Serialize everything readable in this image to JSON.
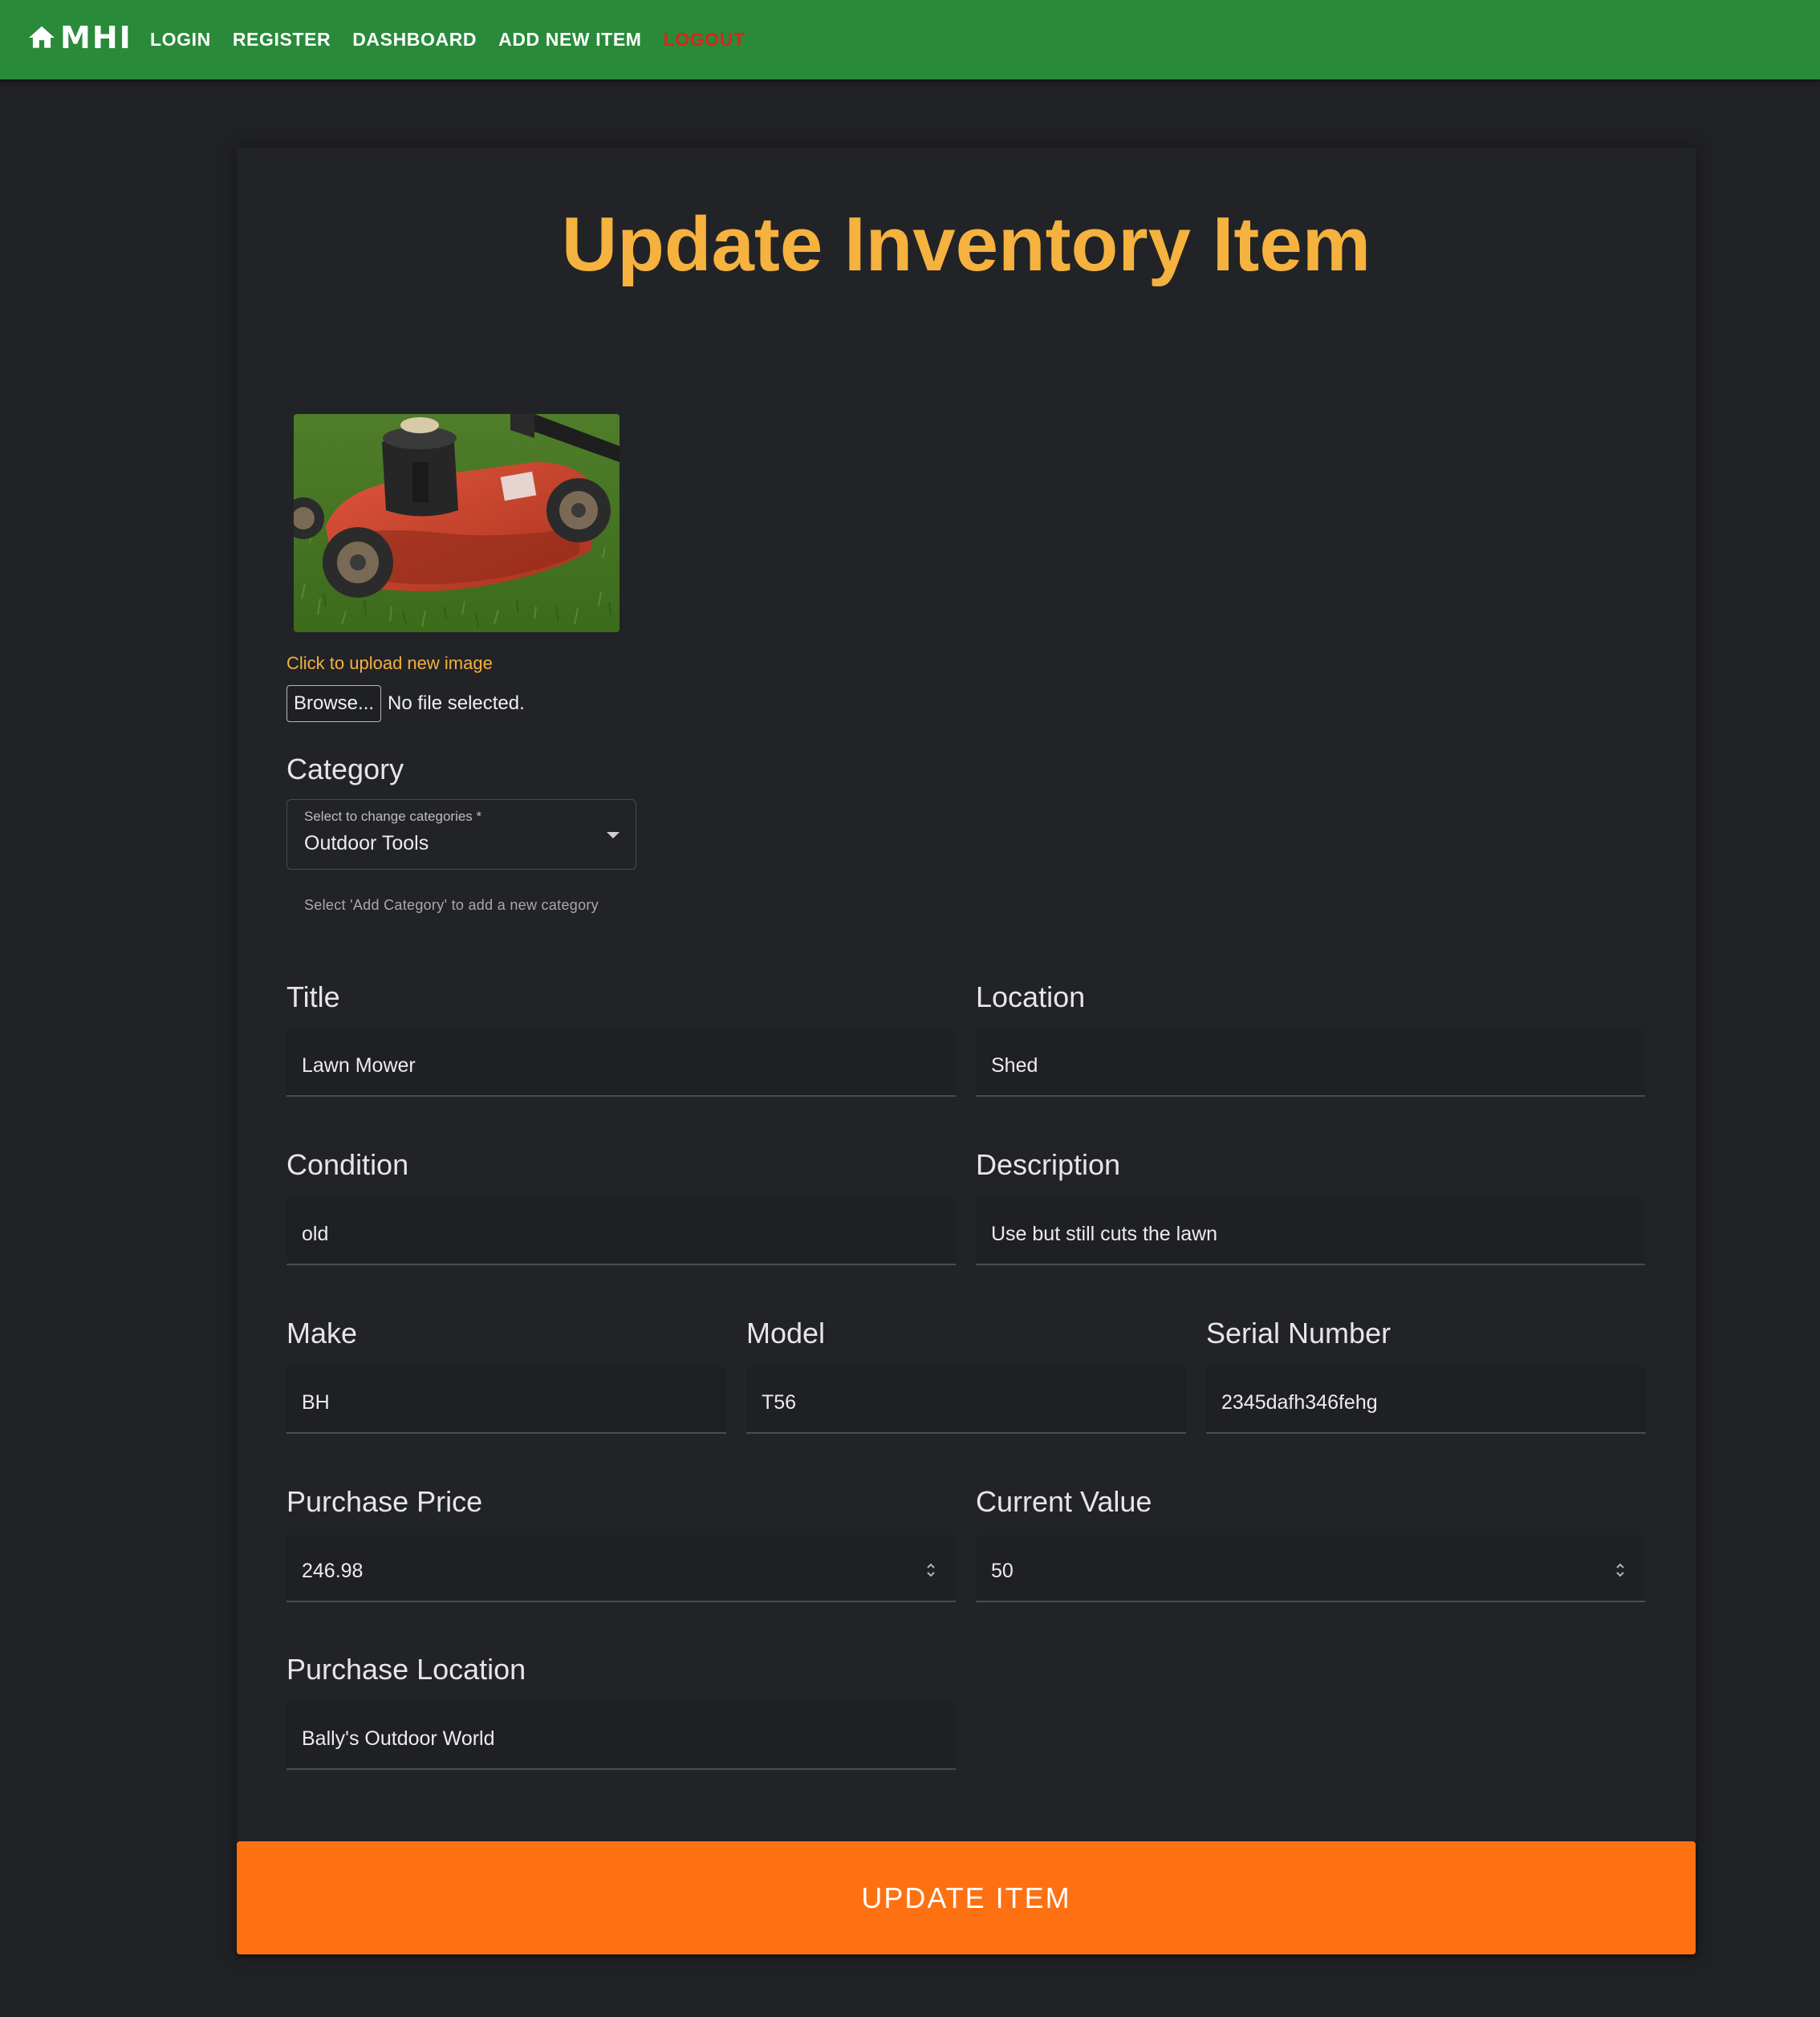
{
  "nav": {
    "brand": "MHI",
    "links": [
      "LOGIN",
      "REGISTER",
      "DASHBOARD",
      "ADD NEW ITEM"
    ],
    "logout": "LOGOUT",
    "logout_color": "#d9261c",
    "bar_color": "#298a3a"
  },
  "page": {
    "title": "Update Inventory Item",
    "title_color": "#f6b23e",
    "image_icon": "lawn-mower-photo"
  },
  "upload": {
    "label": "Click to upload new image",
    "browse_label": "Browse...",
    "status": "No file selected."
  },
  "category": {
    "heading": "Category",
    "select_label": "Select to change categories *",
    "value": "Outdoor Tools",
    "helper": "Select 'Add Category' to add a new category"
  },
  "fields": {
    "title": {
      "label": "Title",
      "value": "Lawn Mower"
    },
    "location": {
      "label": "Location",
      "value": "Shed"
    },
    "condition": {
      "label": "Condition",
      "value": "old"
    },
    "description": {
      "label": "Description",
      "value": "Use but still cuts the lawn"
    },
    "make": {
      "label": "Make",
      "value": "BH"
    },
    "model": {
      "label": "Model",
      "value": "T56"
    },
    "serial": {
      "label": "Serial Number",
      "value": "2345dafh346fehg"
    },
    "purchase_price": {
      "label": "Purchase Price",
      "value": "246.98"
    },
    "current_value": {
      "label": "Current Value",
      "value": "50"
    },
    "purchase_location": {
      "label": "Purchase Location",
      "value": "Bally's Outdoor World"
    }
  },
  "submit": {
    "label": "UPDATE ITEM",
    "color": "#fd7113"
  }
}
